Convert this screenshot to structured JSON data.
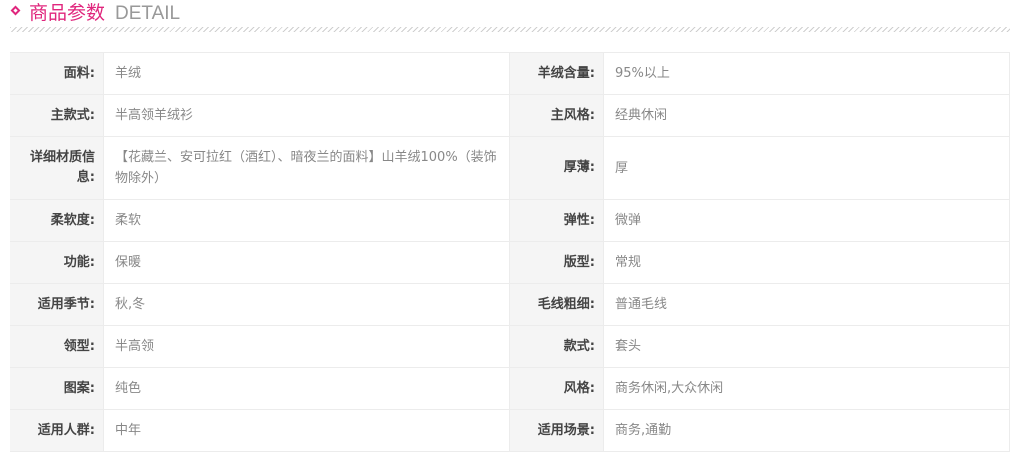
{
  "header": {
    "title_cn": "商品参数",
    "title_en": "DETAIL"
  },
  "rows": [
    {
      "left": {
        "label": "面料:",
        "value": "羊绒"
      },
      "right": {
        "label": "羊绒含量:",
        "value": "95%以上"
      }
    },
    {
      "left": {
        "label": "主款式:",
        "value": "半高领羊绒衫"
      },
      "right": {
        "label": "主风格:",
        "value": "经典休闲"
      }
    },
    {
      "left": {
        "label": "详细材质信息:",
        "value": "【花藏兰、安可拉红（酒红）、暗夜兰的面料】山羊绒100%（装饰物除外）"
      },
      "right": {
        "label": "厚薄:",
        "value": "厚"
      }
    },
    {
      "left": {
        "label": "柔软度:",
        "value": "柔软"
      },
      "right": {
        "label": "弹性:",
        "value": "微弹"
      }
    },
    {
      "left": {
        "label": "功能:",
        "value": "保暖"
      },
      "right": {
        "label": "版型:",
        "value": "常规"
      }
    },
    {
      "left": {
        "label": "适用季节:",
        "value": "秋,冬"
      },
      "right": {
        "label": "毛线粗细:",
        "value": "普通毛线"
      }
    },
    {
      "left": {
        "label": "领型:",
        "value": "半高领"
      },
      "right": {
        "label": "款式:",
        "value": "套头"
      }
    },
    {
      "left": {
        "label": "图案:",
        "value": "纯色"
      },
      "right": {
        "label": "风格:",
        "value": "商务休闲,大众休闲"
      }
    },
    {
      "left": {
        "label": "适用人群:",
        "value": "中年"
      },
      "right": {
        "label": "适用场景:",
        "value": "商务,通勤"
      }
    }
  ],
  "colors": {
    "accent": "#e0267d",
    "label_bg": "#f5f5f5",
    "border": "#ececec"
  }
}
